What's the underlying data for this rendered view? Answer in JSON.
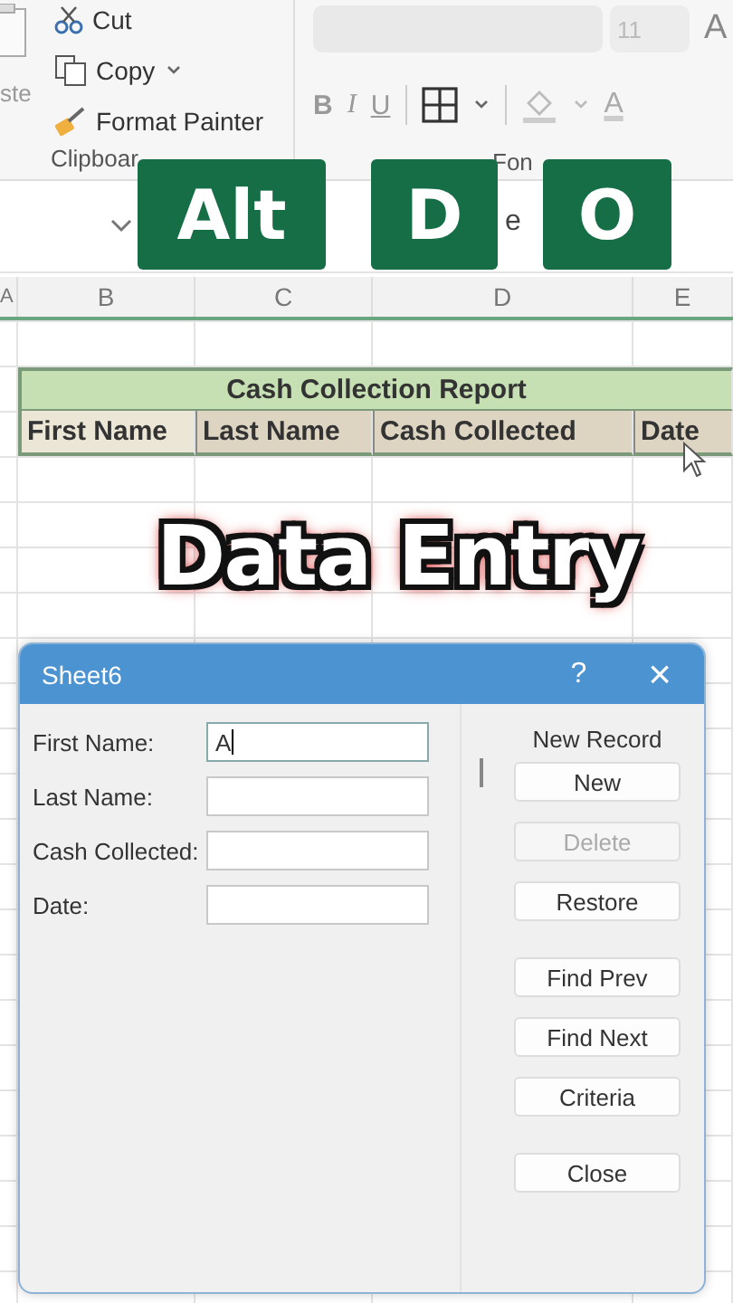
{
  "ribbon": {
    "clipboard": {
      "paste_label": "ste",
      "cut": "Cut",
      "copy": "Copy",
      "format_painter": "Format Painter",
      "group_label": "Clipboar"
    },
    "font": {
      "size": "11",
      "grow_font": "A",
      "bold": "B",
      "italic": "I",
      "underline": "U",
      "font_color": "A",
      "group_label": "Fon"
    }
  },
  "formula_bar": {
    "text": "e"
  },
  "sheet": {
    "columns": [
      "A",
      "B",
      "C",
      "D",
      "E"
    ],
    "title": "Cash Collection Report",
    "headers": [
      "First Name",
      "Last Name",
      "Cash Collected",
      "Date"
    ]
  },
  "keys": [
    "Alt",
    "D",
    "O"
  ],
  "caption": "Data Entry",
  "dialog": {
    "title": "Sheet6",
    "help": "?",
    "close": "×",
    "record_status": "New Record",
    "fields": [
      {
        "label": "First Name:",
        "value": "A",
        "focused": true
      },
      {
        "label": "Last Name:",
        "focused": false
      },
      {
        "label": "Cash Collected:",
        "focused": false
      },
      {
        "label": "Date:",
        "focused": false
      }
    ],
    "button_groups": [
      [
        {
          "label": "New",
          "disabled": false
        },
        {
          "label": "Delete",
          "disabled": true
        },
        {
          "label": "Restore",
          "disabled": false
        }
      ],
      [
        {
          "label": "Find Prev",
          "disabled": false
        },
        {
          "label": "Find Next",
          "disabled": false
        },
        {
          "label": "Criteria",
          "disabled": false
        }
      ],
      [
        {
          "label": "Close",
          "disabled": false
        }
      ]
    ]
  }
}
